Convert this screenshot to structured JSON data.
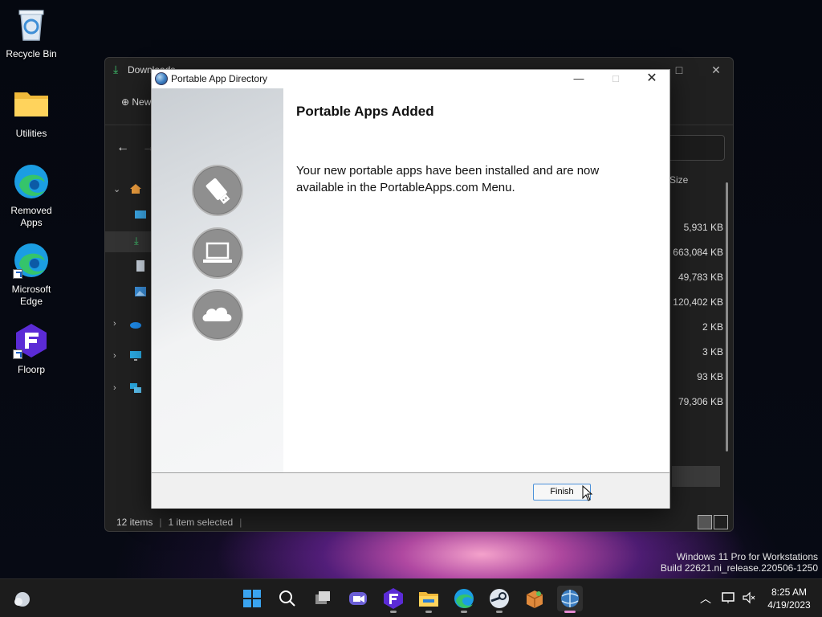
{
  "desktop": {
    "icons": [
      {
        "label": "Recycle Bin"
      },
      {
        "label": "Utilities"
      },
      {
        "label": "Removed Apps"
      },
      {
        "label": "Microsoft Edge"
      },
      {
        "label": "Floorp"
      }
    ]
  },
  "explorer": {
    "title": "Downloads",
    "new_label": "New",
    "size_header": "Size",
    "sizes": [
      "5,931 KB",
      "663,084 KB",
      "49,783 KB",
      "120,402 KB",
      "2 KB",
      "3 KB",
      "93 KB",
      "79,306 KB"
    ],
    "status": {
      "items": "12 items",
      "selected": "1 item selected"
    }
  },
  "dialog": {
    "title": "Portable App Directory",
    "heading": "Portable Apps Added",
    "message": "Your new portable apps have been installed and are now available in the PortableApps.com Menu.",
    "finish_label": "Finish",
    "icons": [
      "usb-drive-icon",
      "laptop-icon",
      "cloud-icon"
    ]
  },
  "watermark": {
    "line1": "Windows 11 Pro for Workstations",
    "line2": "Build 22621.ni_release.220506-1250"
  },
  "taskbar": {
    "time": "8:25 AM",
    "date": "4/19/2023",
    "apps": [
      "start-icon",
      "search-icon",
      "task-view-icon",
      "teams-chat-icon",
      "floorp-icon",
      "file-explorer-icon",
      "edge-icon",
      "steam-icon",
      "installer-box-icon",
      "portable-apps-icon"
    ]
  },
  "colors": {
    "accent": "#4a90d9",
    "active_indicator": "#e58ad1"
  }
}
